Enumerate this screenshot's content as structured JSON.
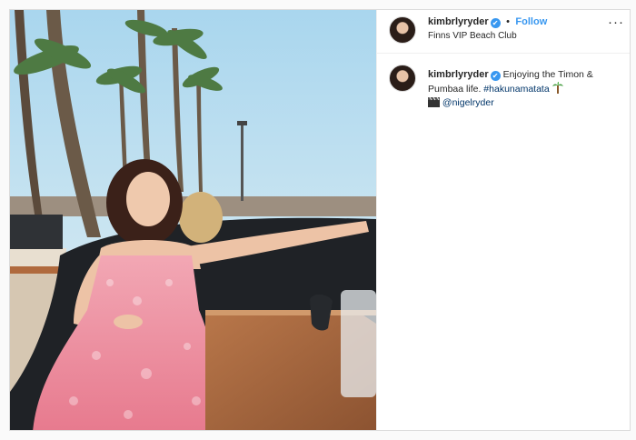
{
  "post": {
    "username": "kimbrlyryder",
    "follow_label": "Follow",
    "separator": "•",
    "location": "Finns VIP Beach Club",
    "more_label": "···",
    "verified_mark": "✔"
  },
  "caption": {
    "username": "kimbrlyryder",
    "text": "Enjoying the Timon & Pumbaa life.",
    "hashtag": "#hakunamatata",
    "mention": "@nigelryder"
  },
  "colors": {
    "link": "#003569",
    "follow": "#3897f0",
    "verified": "#3897f0"
  },
  "icons": [
    "verified-badge-icon",
    "more-options-icon",
    "palm-tree-emoji-icon",
    "clapperboard-emoji-icon"
  ]
}
